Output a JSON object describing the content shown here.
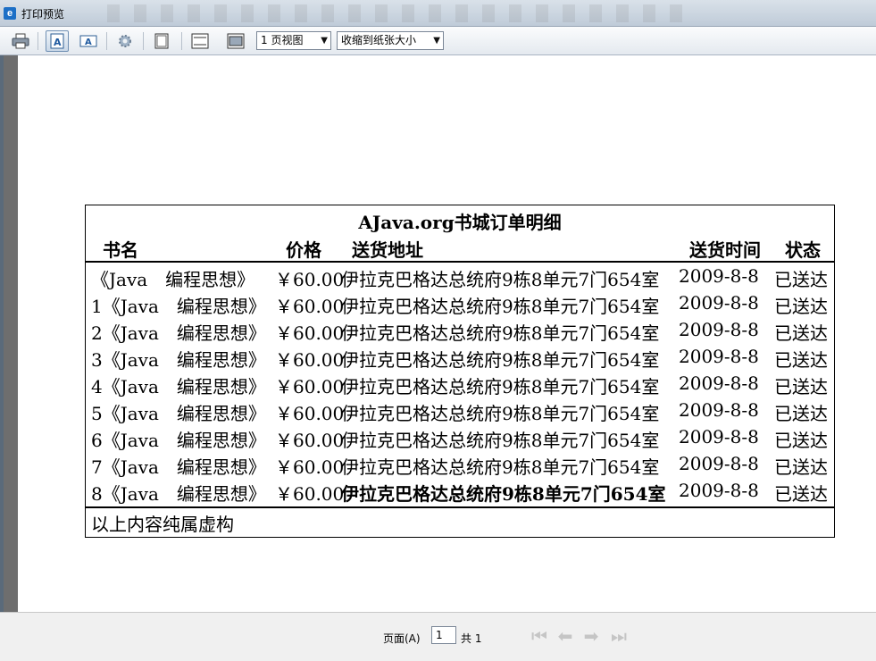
{
  "window": {
    "title": "打印预览"
  },
  "toolbar": {
    "view_select": "1 页视图",
    "scale_select": "收缩到纸张大小"
  },
  "report": {
    "title": "AJava.org书城订单明细",
    "headers": {
      "name": "书名",
      "price": "价格",
      "address": "送货地址",
      "time": "送货时间",
      "status": "状态"
    },
    "rows": [
      {
        "name": "《Java　编程思想》",
        "price": "￥60.00",
        "address": "伊拉克巴格达总统府9栋8单元7门654室",
        "time": "2009-8-8",
        "status": "已送达"
      },
      {
        "name": "1《Java　编程思想》",
        "price": "￥60.00",
        "address": "伊拉克巴格达总统府9栋8单元7门654室",
        "time": "2009-8-8",
        "status": "已送达"
      },
      {
        "name": "2《Java　编程思想》",
        "price": "￥60.00",
        "address": "伊拉克巴格达总统府9栋8单元7门654室",
        "time": "2009-8-8",
        "status": "已送达"
      },
      {
        "name": "3《Java　编程思想》",
        "price": "￥60.00",
        "address": "伊拉克巴格达总统府9栋8单元7门654室",
        "time": "2009-8-8",
        "status": "已送达"
      },
      {
        "name": "4《Java　编程思想》",
        "price": "￥60.00",
        "address": "伊拉克巴格达总统府9栋8单元7门654室",
        "time": "2009-8-8",
        "status": "已送达"
      },
      {
        "name": "5《Java　编程思想》",
        "price": "￥60.00",
        "address": "伊拉克巴格达总统府9栋8单元7门654室",
        "time": "2009-8-8",
        "status": "已送达"
      },
      {
        "name": "6《Java　编程思想》",
        "price": "￥60.00",
        "address": "伊拉克巴格达总统府9栋8单元7门654室",
        "time": "2009-8-8",
        "status": "已送达"
      },
      {
        "name": "7《Java　编程思想》",
        "price": "￥60.00",
        "address": "伊拉克巴格达总统府9栋8单元7门654室",
        "time": "2009-8-8",
        "status": "已送达"
      },
      {
        "name": "8《Java　编程思想》",
        "price": "￥60.00",
        "address": "伊拉克巴格达总统府9栋8单元7门654室",
        "time": "2009-8-8",
        "status": "已送达"
      }
    ],
    "footer": "以上内容纯属虚构"
  },
  "statusbar": {
    "page_label": "页面(A)",
    "page_value": "1",
    "total_label": "共 1"
  },
  "icons": {
    "print": "printer-icon",
    "portrait": "portrait-icon",
    "landscape": "landscape-icon",
    "setup": "gear-icon",
    "fullpage": "page-icon",
    "header": "header-footer-icon",
    "fit": "fit-width-icon"
  }
}
